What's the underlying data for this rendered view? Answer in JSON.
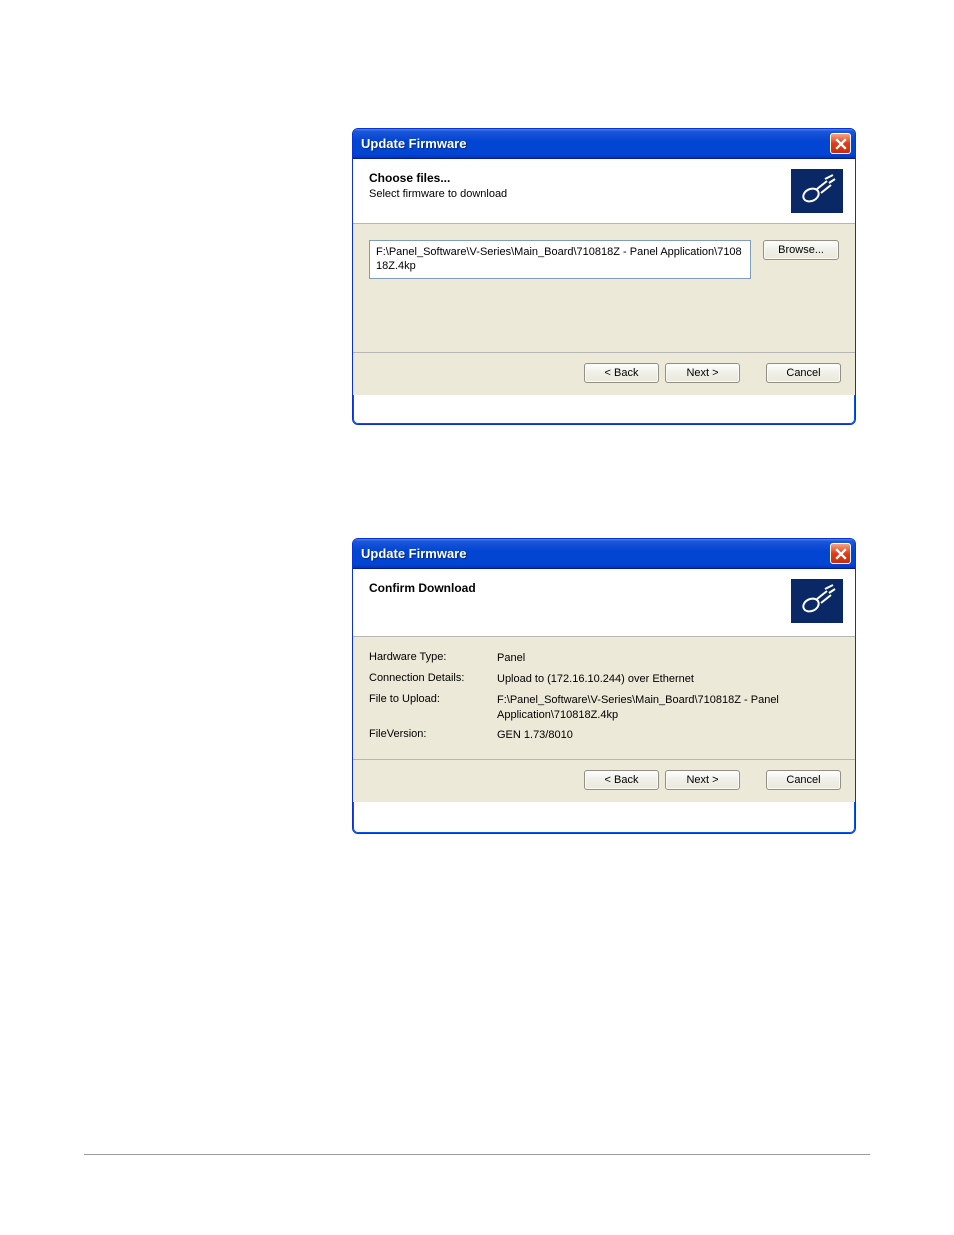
{
  "dialog1": {
    "title": "Update Firmware",
    "heading": "Choose files...",
    "subheading": "Select firmware to download",
    "file_path": "F:\\Panel_Software\\V-Series\\Main_Board\\710818Z - Panel Application\\710818Z.4kp",
    "browse_label": "Browse...",
    "back_label": "< Back",
    "next_label": "Next >",
    "cancel_label": "Cancel"
  },
  "dialog2": {
    "title": "Update Firmware",
    "heading": "Confirm Download",
    "rows": {
      "hardware_label": "Hardware Type:",
      "hardware_value": "Panel",
      "connection_label": "Connection Details:",
      "connection_value": "Upload to  (172.16.10.244) over Ethernet",
      "file_label": "File to Upload:",
      "file_value": "F:\\Panel_Software\\V-Series\\Main_Board\\710818Z - Panel Application\\710818Z.4kp",
      "version_label": "FileVersion:",
      "version_value": "GEN 1.73/8010"
    },
    "back_label": "< Back",
    "next_label": "Next >",
    "cancel_label": "Cancel"
  }
}
